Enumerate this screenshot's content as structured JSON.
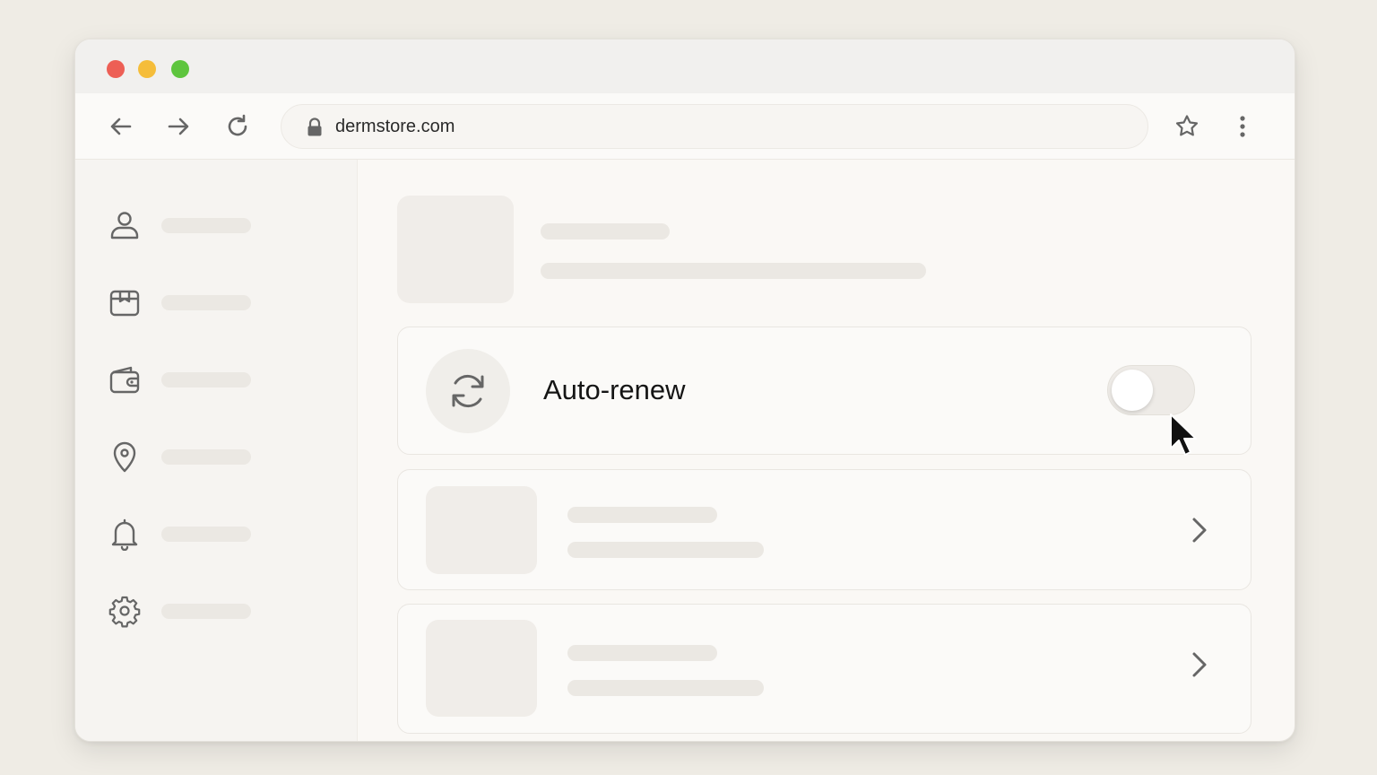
{
  "browser": {
    "url": "dermstore.com",
    "traffic_lights": {
      "close": "#ed5f55",
      "minimize": "#f5bd3a",
      "maximize": "#5ec53e"
    }
  },
  "toolbar_icons": [
    "back-arrow-icon",
    "forward-arrow-icon",
    "reload-icon",
    "lock-icon",
    "bookmark-star-icon",
    "more-menu-icon"
  ],
  "sidebar": {
    "items": [
      {
        "icon": "user-icon"
      },
      {
        "icon": "package-icon"
      },
      {
        "icon": "wallet-icon"
      },
      {
        "icon": "location-pin-icon"
      },
      {
        "icon": "bell-icon"
      },
      {
        "icon": "gear-icon"
      }
    ]
  },
  "auto_renew": {
    "label": "Auto-renew",
    "icon": "refresh-icon",
    "enabled": false
  },
  "list_rows": [
    {
      "icon": "chevron-right-icon"
    },
    {
      "icon": "chevron-right-icon"
    }
  ],
  "colors": {
    "icon": "#6b6b6b",
    "placeholder": "#ebe8e3",
    "background": "#efece5"
  }
}
